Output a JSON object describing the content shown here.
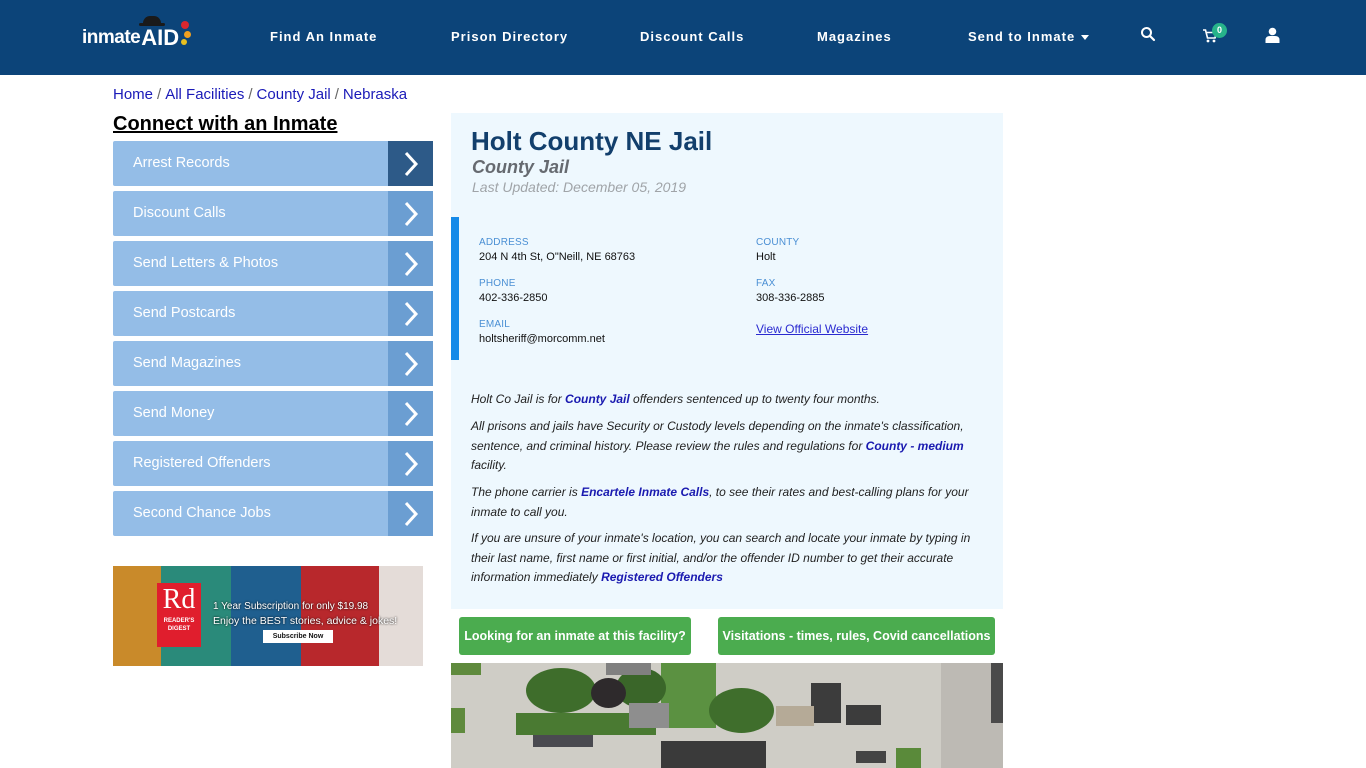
{
  "header": {
    "logo_text": "inmate",
    "logo_accent": "AID",
    "nav": [
      {
        "label": "Find An Inmate"
      },
      {
        "label": "Prison Directory"
      },
      {
        "label": "Discount Calls"
      },
      {
        "label": "Magazines"
      },
      {
        "label": "Send to Inmate",
        "has_dropdown": true
      }
    ],
    "icons": {
      "search": "search-icon",
      "cart": "cart-icon",
      "user": "user-icon"
    },
    "cart_count": "0",
    "colors": {
      "background": "#0c4479",
      "badge": "#27b38a"
    }
  },
  "breadcrumb": [
    {
      "label": "Home"
    },
    {
      "label": "All Facilities"
    },
    {
      "label": "County Jail"
    },
    {
      "label": "Nebraska"
    }
  ],
  "sidebar": {
    "title": "Connect with an Inmate",
    "items": [
      {
        "label": "Arrest Records"
      },
      {
        "label": "Discount Calls"
      },
      {
        "label": "Send Letters & Photos"
      },
      {
        "label": "Send Postcards"
      },
      {
        "label": "Send Magazines"
      },
      {
        "label": "Send Money"
      },
      {
        "label": "Registered Offenders"
      },
      {
        "label": "Second Chance Jobs"
      }
    ],
    "colors": {
      "item": "#94bde7",
      "arrow": "#6b9ed2",
      "arrow_active": "#2d5a88"
    }
  },
  "ad": {
    "brand_short": "Rd",
    "brand_name": "READER'S DIGEST",
    "line1": "1 Year Subscription for only $19.98",
    "line2": "Enjoy the BEST stories, advice & jokes!",
    "button": "Subscribe Now"
  },
  "facility": {
    "name": "Holt County NE Jail",
    "type": "County Jail",
    "last_updated": "Last Updated: December 05, 2019",
    "address_label": "ADDRESS",
    "address": "204 N 4th St, O\"Neill, NE 68763",
    "county_label": "COUNTY",
    "county": "Holt",
    "phone_label": "PHONE",
    "phone": "402-336-2850",
    "fax_label": "FAX",
    "fax": "308-336-2885",
    "email_label": "EMAIL",
    "email": "holtsheriff@morcomm.net",
    "website_link": "View Official Website"
  },
  "description": {
    "p1_pre": "Holt Co Jail is for ",
    "p1_link": "County Jail",
    "p1_post": " offenders sentenced up to twenty four months.",
    "p2_pre": "All prisons and jails have Security or Custody levels depending on the inmate's classification, sentence, and criminal history. Please review the rules and regulations for ",
    "p2_link": "County - medium",
    "p2_post": " facility.",
    "p3_pre": "The phone carrier is ",
    "p3_link": "Encartele Inmate Calls",
    "p3_post": ", to see their rates and best-calling plans for your inmate to call you.",
    "p4_pre": "If you are unsure of your inmate's location, you can search and locate your inmate by typing in their last name, first name or first initial, and/or the offender ID number to get their accurate information immediately ",
    "p4_link": "Registered Offenders"
  },
  "actions": {
    "find_inmate": "Looking for an inmate at this facility?",
    "visitations": "Visitations - times, rules, Covid cancellations",
    "color": "#4bac4f"
  },
  "map": {
    "type": "satellite-image"
  }
}
